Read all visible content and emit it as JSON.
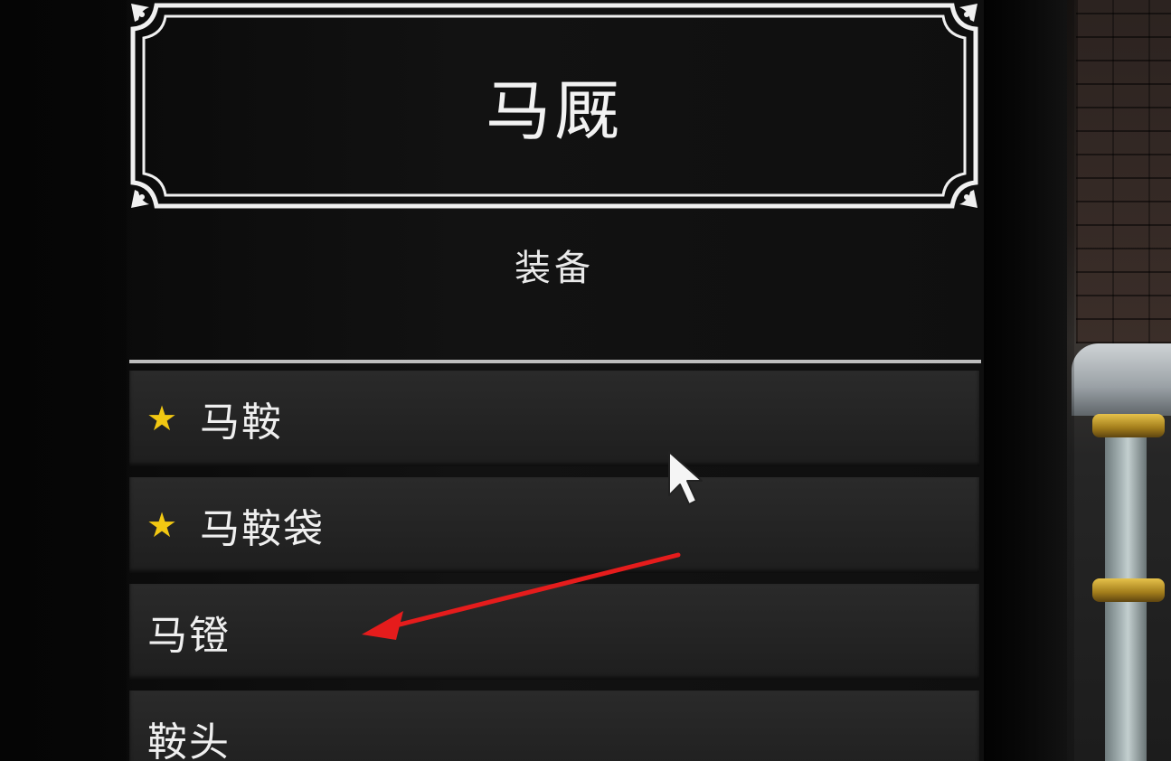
{
  "menu": {
    "title": "马厩",
    "section": "装备",
    "items": [
      {
        "label": "马鞍",
        "starred": true
      },
      {
        "label": "马鞍袋",
        "starred": true
      },
      {
        "label": "马镫",
        "starred": false
      },
      {
        "label": "鞍头",
        "starred": false
      }
    ]
  },
  "colors": {
    "star": "#f2c812",
    "annotation_arrow": "#e51c1c",
    "text": "#efefef",
    "row_bg": "#262626"
  },
  "icons": {
    "star": "star-icon",
    "cursor": "mouse-cursor-icon",
    "annotation": "red-arrow-annotation"
  }
}
